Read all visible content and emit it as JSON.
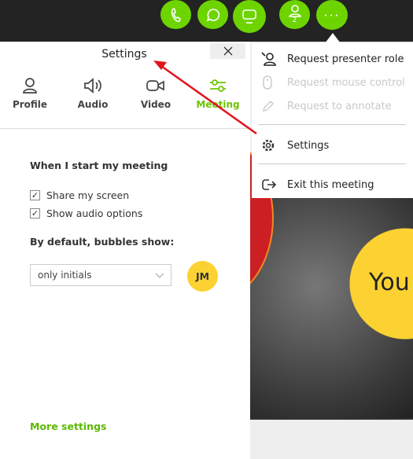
{
  "toolbar": {
    "buttons": [
      {
        "name": "call",
        "icon": "phone-icon"
      },
      {
        "name": "chat",
        "icon": "chat-icon"
      },
      {
        "name": "share",
        "icon": "screen-icon"
      },
      {
        "name": "participants",
        "icon": "person-icon",
        "badge": "2"
      },
      {
        "name": "more",
        "icon": "ellipsis-icon"
      }
    ],
    "accent": "#6dd400"
  },
  "settings": {
    "title": "Settings",
    "tabs": [
      {
        "label": "Profile"
      },
      {
        "label": "Audio"
      },
      {
        "label": "Video"
      },
      {
        "label": "Meeting",
        "active": true
      }
    ],
    "section1": "When I start my meeting",
    "options": [
      {
        "label": "Share my screen",
        "checked": true
      },
      {
        "label": "Show audio options",
        "checked": true
      }
    ],
    "section2": "By default, bubbles show:",
    "bubble_select": "only initials",
    "avatar_initials": "JM",
    "more_settings": "More settings"
  },
  "menu": {
    "items": [
      {
        "label": "Request presenter role",
        "enabled": true
      },
      {
        "label": "Request mouse control",
        "enabled": false
      },
      {
        "label": "Request to annotate",
        "enabled": false
      },
      {
        "label": "Settings",
        "enabled": true
      },
      {
        "label": "Exit this meeting",
        "enabled": true
      }
    ]
  },
  "stage": {
    "bubble_text": "You"
  }
}
